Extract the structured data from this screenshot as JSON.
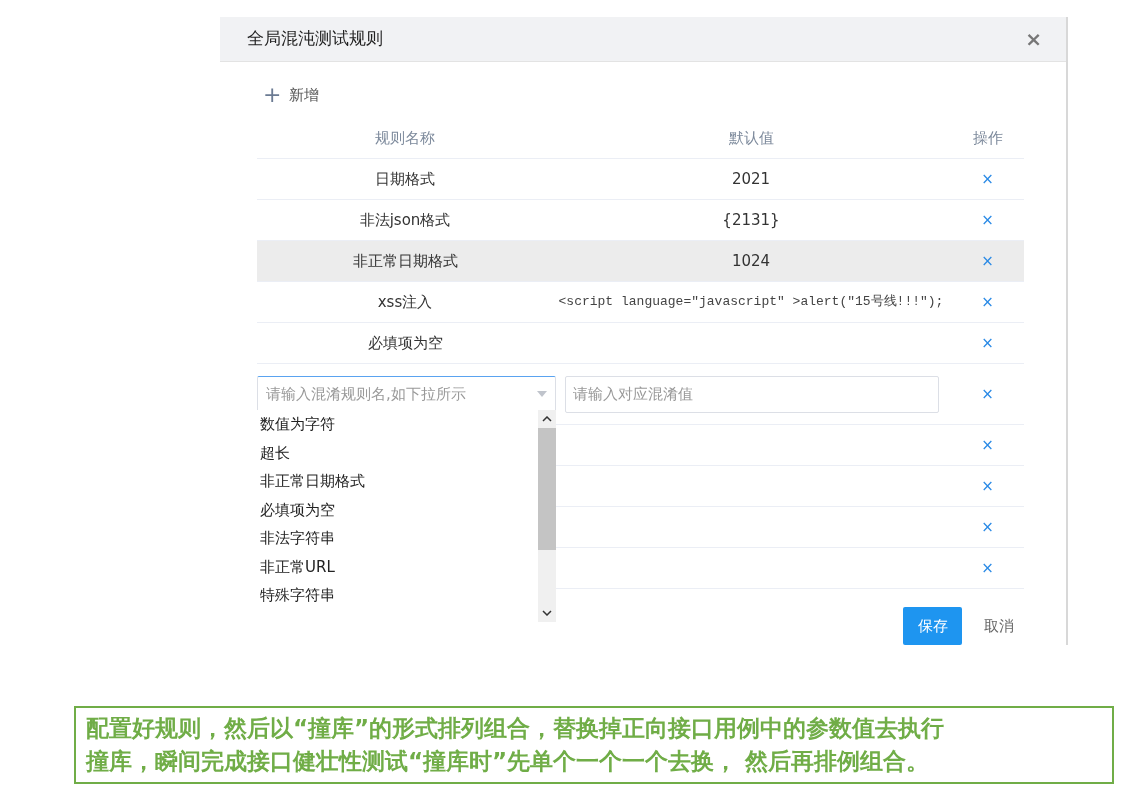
{
  "dialog": {
    "title": "全局混沌测试规则",
    "close": "×"
  },
  "add_button": {
    "icon": "+",
    "label": "新增"
  },
  "table": {
    "columns": [
      "规则名称",
      "默认值",
      "操作"
    ],
    "rows": [
      {
        "kind": "rule",
        "name": "日期格式",
        "value": "2021",
        "delete": "×",
        "highlighted": false
      },
      {
        "kind": "rule",
        "name": "非法json格式",
        "value": "{2131}",
        "delete": "×",
        "highlighted": false
      },
      {
        "kind": "rule",
        "name": "非正常日期格式",
        "value": "1024",
        "delete": "×",
        "highlighted": true
      },
      {
        "kind": "rule",
        "name": "xss注入",
        "value": "<script language=\"javascript\" >alert(\"15号线!!!\");",
        "delete": "×",
        "highlighted": false,
        "mono": true
      },
      {
        "kind": "rule",
        "name": "必填项为空",
        "delete": "×",
        "highlighted": false
      },
      {
        "kind": "edit",
        "name_placeholder": "请输入混淆规则名,如下拉所示",
        "value_placeholder": "请输入对应混淆值",
        "delete": "×",
        "expanded": true
      },
      {
        "kind": "blank",
        "delete": "×"
      },
      {
        "kind": "blank",
        "delete": "×"
      },
      {
        "kind": "blank",
        "delete": "×"
      },
      {
        "kind": "blank",
        "delete": "×"
      }
    ]
  },
  "dropdown": {
    "options": [
      "数值为字符",
      "超长",
      "非正常日期格式",
      "必填项为空",
      "非法字符串",
      "非正常URL",
      "特殊字符串"
    ]
  },
  "buttons": [
    {
      "kind": "primary",
      "label": "保存"
    },
    {
      "kind": "plain",
      "label": "取消"
    }
  ],
  "caption": {
    "lines": [
      "配置好规则，然后以“撞库”的形式排列组合，替换掉正向接口用例中的参数值去执行",
      "撞库，瞬间完成接口健壮性测试“撞库时”先单个一个一个去换， 然后再排例组合。"
    ]
  }
}
